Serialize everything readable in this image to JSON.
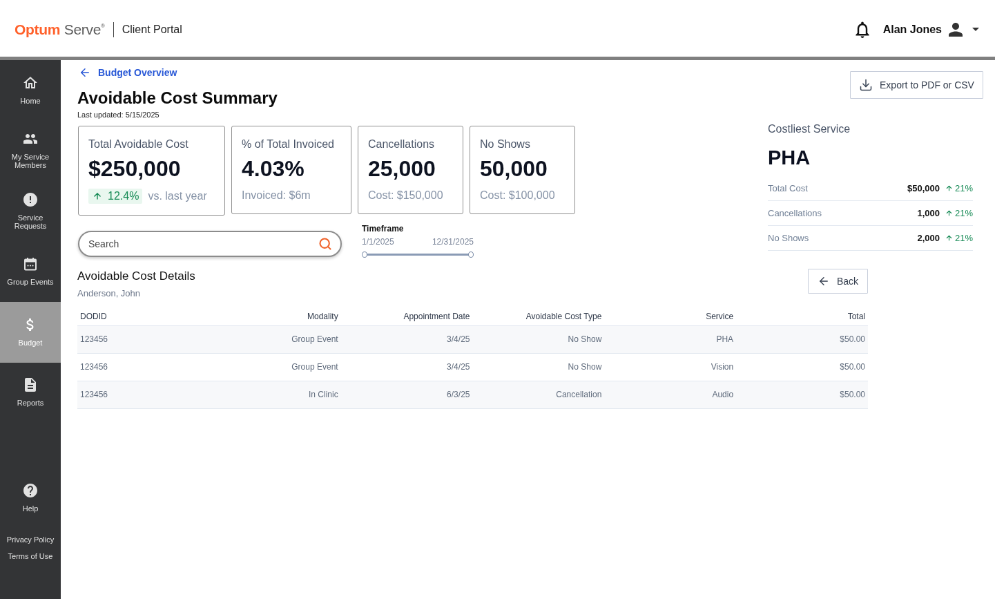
{
  "header": {
    "logo": "**Optum** Serve$^{®}$",
    "portal_name": "Client Portal",
    "user_name": "Alan Jones"
  },
  "sidebar": {
    "items": [
      {
        "label": "Home",
        "selected": false
      },
      {
        "label": "My Service Members",
        "selected": false
      },
      {
        "label": "Service Requests",
        "selected": false
      },
      {
        "label": "Group Events",
        "selected": false
      },
      {
        "label": "Budget",
        "selected": true
      },
      {
        "label": "Reports",
        "selected": false
      }
    ],
    "help": "Help",
    "footer_links": [
      "Privacy Policy",
      "Terms of Use"
    ]
  },
  "breadcrumb": {
    "label": "Budget Overview"
  },
  "page": {
    "title": "Avoidable Cost Summary",
    "last_updated": "Last updated: 5/15/2025"
  },
  "export_button": "Export to PDF or CSV",
  "stat_cards": [
    {
      "title": "Total Avoidable Cost",
      "value": "$250,000",
      "change": "12.4%",
      "note": "vs. last year"
    },
    {
      "title": "% of Total Invoiced",
      "value": "4.03%",
      "note": "Invoiced: $6m"
    },
    {
      "title": "Cancellations",
      "value": "25,000",
      "note": "Cost: $150,000"
    },
    {
      "title": "No Shows",
      "value": "50,000",
      "note": "Cost: $100,000"
    }
  ],
  "search": {
    "placeholder": "Search"
  },
  "timeframe": {
    "label": "Timeframe",
    "start": "1/1/2025",
    "end": "12/31/2025",
    "level": 1
  },
  "costliest_service": {
    "title": "Costliest Service",
    "service": "PHA",
    "rows": [
      {
        "label": "Total Cost",
        "value": "$50,000",
        "change": "21%"
      },
      {
        "label": "Cancellations",
        "value": "1,000",
        "change": "21%"
      },
      {
        "label": "No Shows",
        "value": "2,000",
        "change": "21%"
      }
    ]
  },
  "details": {
    "title": "Avoidable Cost Details",
    "member": "Anderson, John",
    "back_button": "Back",
    "table": {
      "columns": [
        "DODID",
        "Modality",
        "Appointment Date",
        "Avoidable Cost Type",
        "Service",
        "Total"
      ],
      "rows": [
        [
          "123456",
          "Group Event",
          "3/4/25",
          "No Show",
          "PHA",
          "$50.00"
        ],
        [
          "123456",
          "Group Event",
          "3/4/25",
          "No Show",
          "Vision",
          "$50.00"
        ],
        [
          "123456",
          "In Clinic",
          "6/3/25",
          "Cancellation",
          "Audio",
          "$50.00"
        ]
      ]
    }
  }
}
